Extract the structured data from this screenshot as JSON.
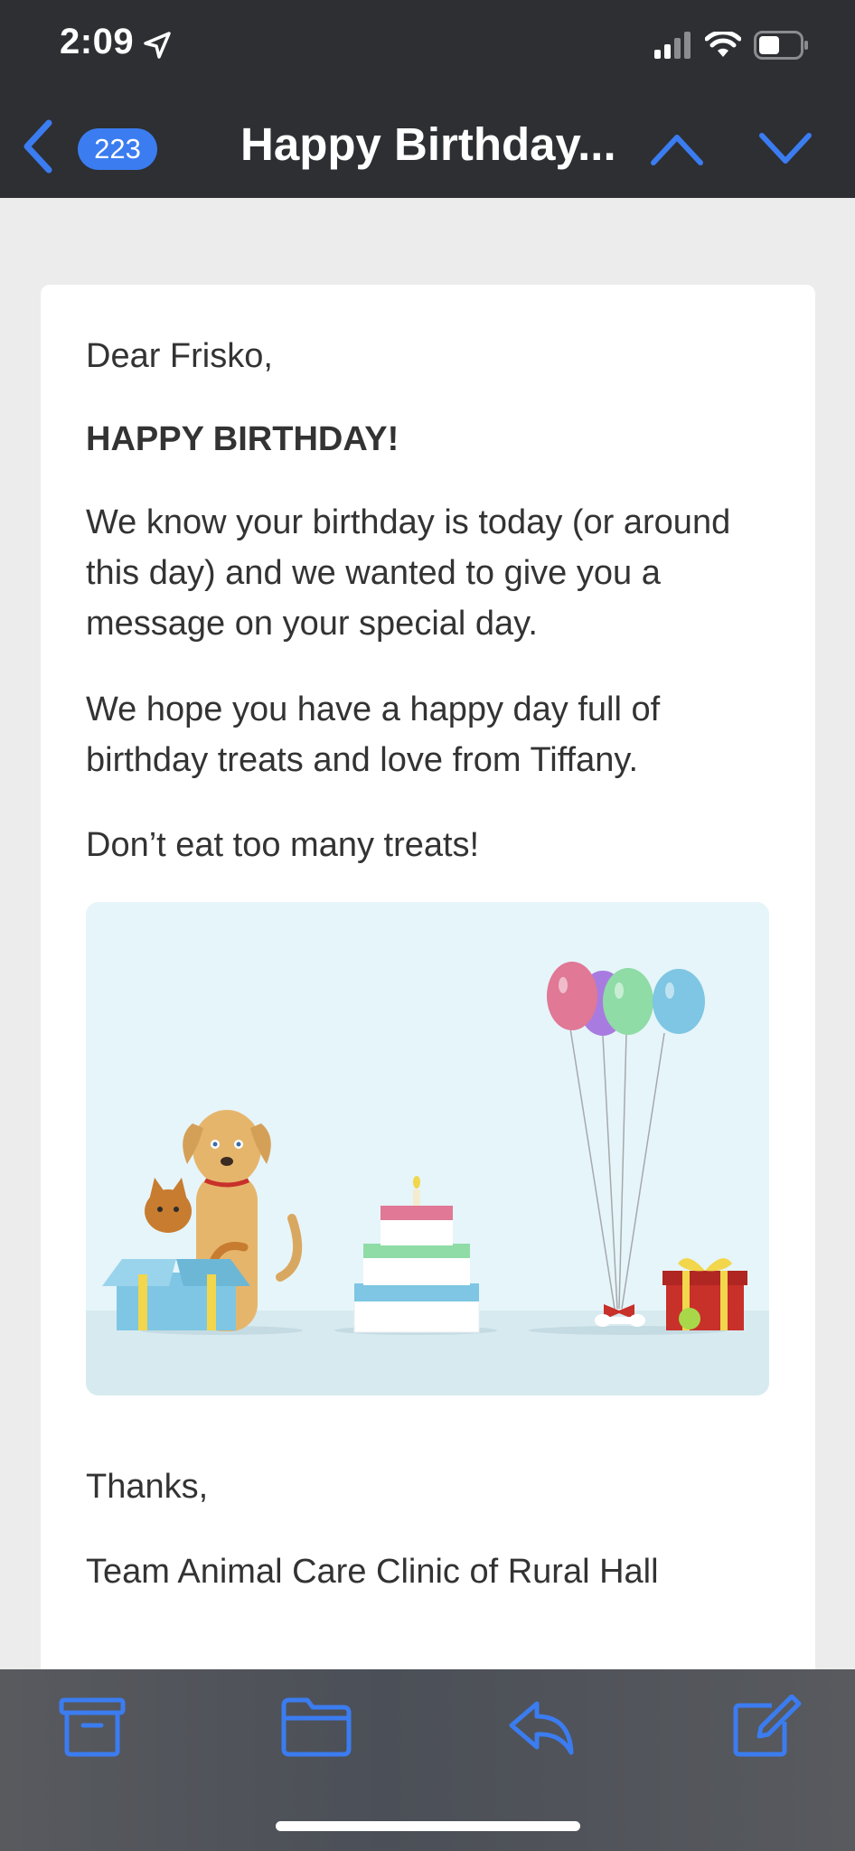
{
  "status_bar": {
    "time": "2:09"
  },
  "nav": {
    "unread_count": "223",
    "title": "Happy Birthday..."
  },
  "email": {
    "greeting": "Dear Frisko,",
    "headline": "HAPPY BIRTHDAY!",
    "paragraphs": [
      "We know your birthday is today (or around this day) and we wanted to give you a message on your special day.",
      "We hope you have a happy day full of birthday treats and love from Tiffany.",
      "Don’t eat too many treats!"
    ],
    "closing": "Thanks,",
    "signature": "Team Animal Care Clinic of Rural Hall"
  },
  "toolbar": {
    "icons": [
      "archive-icon",
      "folder-icon",
      "reply-icon",
      "compose-icon"
    ]
  },
  "colors": {
    "accent": "#3b7cf0",
    "nav_bg": "#2d2f33",
    "toolbar_bg": "#52555a"
  }
}
